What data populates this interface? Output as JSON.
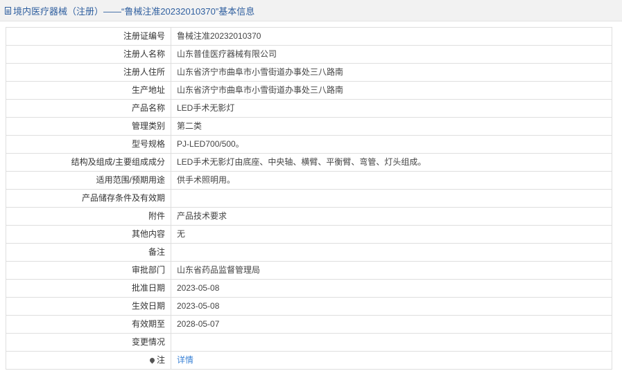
{
  "header": {
    "icon": "document-icon",
    "title": "境内医疗器械（注册）——“鲁械注准20232010370”基本信息"
  },
  "rows": [
    {
      "label": "注册证编号",
      "value": "鲁械注准20232010370"
    },
    {
      "label": "注册人名称",
      "value": "山东普佳医疗器械有限公司"
    },
    {
      "label": "注册人住所",
      "value": "山东省济宁市曲阜市小雪街道办事处三八路南"
    },
    {
      "label": "生产地址",
      "value": "山东省济宁市曲阜市小雪街道办事处三八路南"
    },
    {
      "label": "产品名称",
      "value": "LED手术无影灯"
    },
    {
      "label": "管理类别",
      "value": "第二类"
    },
    {
      "label": "型号规格",
      "value": "PJ-LED700/500。"
    },
    {
      "label": "结构及组成/主要组成成分",
      "value": "LED手术无影灯由底座、中央轴、横臂、平衡臂、弯管、灯头组成。"
    },
    {
      "label": "适用范围/预期用途",
      "value": "供手术照明用。"
    },
    {
      "label": "产品储存条件及有效期",
      "value": ""
    },
    {
      "label": "附件",
      "value": "产品技术要求"
    },
    {
      "label": "其他内容",
      "value": "无"
    },
    {
      "label": "备注",
      "value": ""
    },
    {
      "label": "审批部门",
      "value": "山东省药品监督管理局"
    },
    {
      "label": "批准日期",
      "value": "2023-05-08"
    },
    {
      "label": "生效日期",
      "value": "2023-05-08"
    },
    {
      "label": "有效期至",
      "value": "2028-05-07"
    },
    {
      "label": "变更情况",
      "value": ""
    }
  ],
  "last_row": {
    "label_icon": "pin-icon",
    "label": "注",
    "link": "详情"
  }
}
